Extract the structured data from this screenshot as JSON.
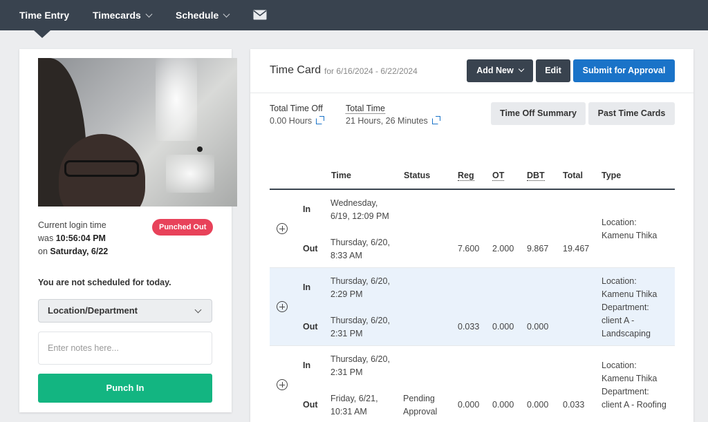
{
  "nav": {
    "items": [
      {
        "label": "Time Entry",
        "active": true
      },
      {
        "label": "Timecards",
        "dropdown": true
      },
      {
        "label": "Schedule",
        "dropdown": true
      }
    ],
    "mail_icon": "envelope-icon"
  },
  "left": {
    "login_line1": "Current login time",
    "login_line2_prefix": "was ",
    "login_time": "10:56:04 PM",
    "login_line3_prefix": "on ",
    "login_date": "Saturday, 6/22",
    "status_badge": "Punched Out",
    "not_scheduled": "You are not scheduled for today.",
    "location_select": "Location/Department",
    "notes_placeholder": "Enter notes here...",
    "punch_button": "Punch In"
  },
  "timecard": {
    "title": "Time Card",
    "range": "for 6/16/2024 - 6/22/2024",
    "add_new": "Add New",
    "edit": "Edit",
    "submit": "Submit for Approval",
    "total_time_off_label": "Total Time Off",
    "total_time_off_value": "0.00 Hours",
    "total_time_label": "Total Time",
    "total_time_value": "21 Hours, 26 Minutes",
    "time_off_summary": "Time Off Summary",
    "past_time_cards": "Past Time Cards",
    "columns": [
      "Time",
      "Status",
      "Reg",
      "OT",
      "DBT",
      "Total",
      "Type"
    ],
    "in_label": "In",
    "out_label": "Out",
    "rows": [
      {
        "in_time": [
          "Wednesday,",
          "6/19, 12:09 PM"
        ],
        "out_time": [
          "Thursday, 6/20,",
          "8:33 AM"
        ],
        "status": [
          "",
          ""
        ],
        "reg": "7.600",
        "ot": "2.000",
        "dbt": "9.867",
        "total": "19.467",
        "type": [
          "Location:",
          "Kamenu Thika"
        ]
      },
      {
        "in_time": [
          "Thursday, 6/20,",
          "2:29 PM"
        ],
        "out_time": [
          "Thursday, 6/20,",
          "2:31 PM"
        ],
        "status": [
          "",
          ""
        ],
        "reg": "0.033",
        "ot": "0.000",
        "dbt": "0.000",
        "total": "",
        "type": [
          "Location:",
          "Kamenu Thika",
          "Department:",
          "client A -",
          "Landscaping"
        ]
      },
      {
        "in_time": [
          "Thursday, 6/20,",
          "2:31 PM"
        ],
        "out_time": [
          "Friday, 6/21,",
          "10:31 AM"
        ],
        "status": [
          "Pending",
          "Approval"
        ],
        "reg": "0.000",
        "ot": "0.000",
        "dbt": "0.000",
        "total": "0.033",
        "type": [
          "Location:",
          "Kamenu Thika",
          "Department:",
          "client A - Roofing"
        ]
      }
    ]
  }
}
